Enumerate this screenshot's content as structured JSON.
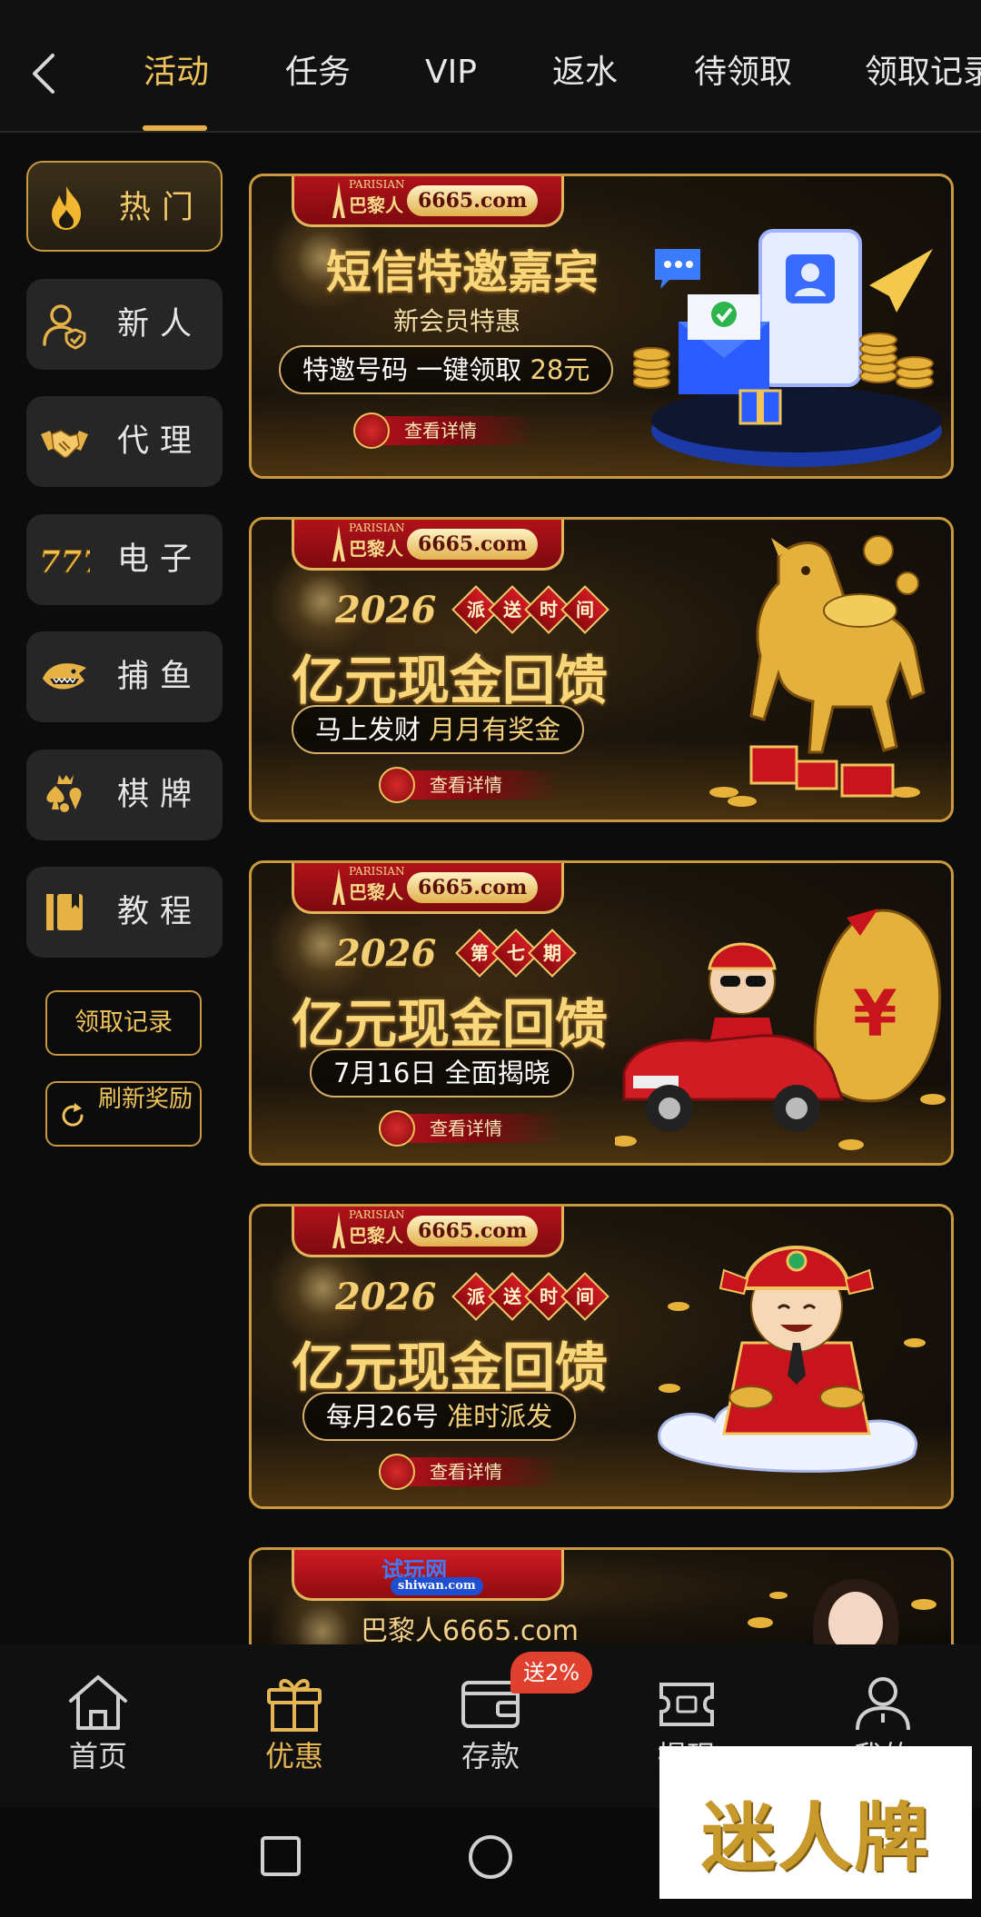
{
  "top_nav": {
    "tabs": [
      {
        "label": "活动",
        "active": true
      },
      {
        "label": "任务"
      },
      {
        "label": "VIP"
      },
      {
        "label": "返水"
      },
      {
        "label": "待领取"
      },
      {
        "label": "领取记录"
      }
    ]
  },
  "sidebar": {
    "items": [
      {
        "label": "热门",
        "icon": "fire-icon",
        "active": true
      },
      {
        "label": "新人",
        "icon": "new-user-icon"
      },
      {
        "label": "代理",
        "icon": "handshake-icon"
      },
      {
        "label": "电子",
        "icon": "slot-777-icon"
      },
      {
        "label": "捕鱼",
        "icon": "shark-icon"
      },
      {
        "label": "棋牌",
        "icon": "card-suits-icon"
      },
      {
        "label": "教程",
        "icon": "book-icon"
      }
    ],
    "records_button": "领取记录",
    "refresh_button": "刷新奖励"
  },
  "banners": [
    {
      "brand_small": "PARISIAN",
      "brand_cn": "巴黎人",
      "brand_domain": "6665.com",
      "title": "短信特邀嘉宾",
      "subtitle": "新会员特惠",
      "pill_main": "特邀号码 一键领取 ",
      "pill_highlight": "28元",
      "detail": "查看详情"
    },
    {
      "brand_small": "PARISIAN",
      "brand_cn": "巴黎人",
      "brand_domain": "6665.com",
      "year": "2026",
      "tag_chars": [
        "派",
        "送",
        "时",
        "间"
      ],
      "title": "亿元现金回馈",
      "pill_main": "马上发财 ",
      "pill_highlight": "月月有奖金",
      "detail": "查看详情"
    },
    {
      "brand_small": "PARISIAN",
      "brand_cn": "巴黎人",
      "brand_domain": "6665.com",
      "year": "2026",
      "tag_chars": [
        "第",
        "七",
        "期"
      ],
      "title": "亿元现金回馈",
      "pill_main": "7月16日 全面揭晓",
      "pill_highlight": "",
      "detail": "查看详情"
    },
    {
      "brand_small": "PARISIAN",
      "brand_cn": "巴黎人",
      "brand_domain": "6665.com",
      "year": "2026",
      "tag_chars": [
        "派",
        "送",
        "时",
        "间"
      ],
      "title": "亿元现金回馈",
      "pill_main": "每月26号 ",
      "pill_highlight": "准时派发",
      "detail": "查看详情"
    },
    {
      "brand_cn": "试玩网",
      "brand_domain": "shiwan.com",
      "subtitle": "巴黎人6665.com"
    }
  ],
  "bottom_nav": {
    "items": [
      {
        "label": "首页",
        "icon": "home-icon"
      },
      {
        "label": "优惠",
        "icon": "gift-icon",
        "active": true
      },
      {
        "label": "存款",
        "icon": "wallet-icon"
      },
      {
        "label": "提现",
        "icon": "ticket-icon"
      },
      {
        "label": "我的",
        "icon": "profile-icon"
      }
    ],
    "deposit_badge": "送2%"
  },
  "watermark": "迷人牌",
  "colors": {
    "accent_gold": "#f0c35a",
    "background": "#0c0c0c",
    "badge_red": "#e0412f"
  }
}
